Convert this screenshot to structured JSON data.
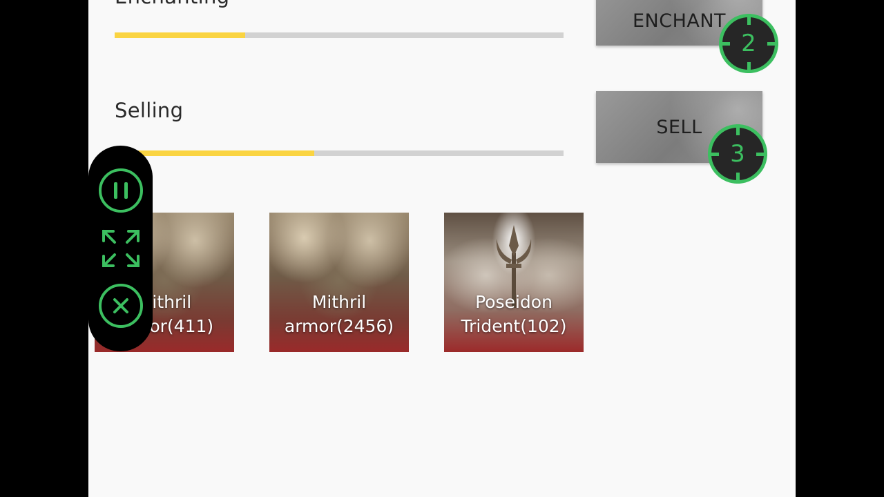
{
  "rows": [
    {
      "label": "Enchanting",
      "progress": 0.29,
      "button_label": "ENCHANT",
      "marker_number": "2"
    },
    {
      "label": "Selling",
      "progress": 0.445,
      "button_label": "SELL",
      "marker_number": "3"
    }
  ],
  "items": [
    {
      "label": "Mithril armor(411)",
      "art": "armor"
    },
    {
      "label": "Mithril armor(2456)",
      "art": "armor"
    },
    {
      "label": "Poseidon Trident(102)",
      "art": "trident"
    }
  ],
  "floating_controls": [
    {
      "icon": "pause-icon"
    },
    {
      "icon": "expand-icon"
    },
    {
      "icon": "close-icon"
    }
  ],
  "colors": {
    "background": "#f9f9f9",
    "progress_fill": "#fad442",
    "progress_track": "#d2d2d2",
    "marker_green": "#3cbf60",
    "button_gray": "#8c8c8c"
  }
}
